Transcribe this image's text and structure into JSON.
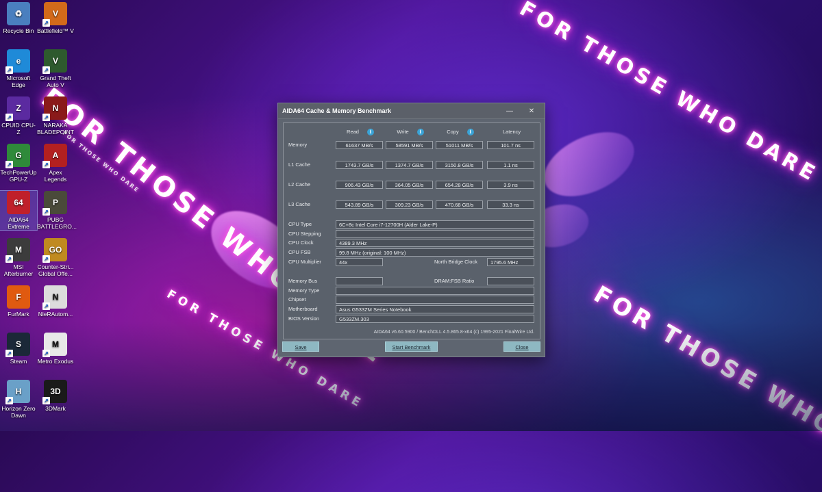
{
  "wallpaper": {
    "slogan": "FOR THOSE WHO DARE"
  },
  "desktop": {
    "icons": [
      {
        "label": "Recycle Bin",
        "icon": "recycle-bin-icon",
        "color": "#4a7fbf",
        "glyph": "♻",
        "shortcut": false
      },
      {
        "label": "Battlefield™ V",
        "icon": "battlefield-icon",
        "color": "#d36a1a",
        "glyph": "V",
        "shortcut": true
      },
      {
        "label": "Microsoft Edge",
        "icon": "edge-icon",
        "color": "#1f8ad8",
        "glyph": "e",
        "shortcut": true
      },
      {
        "label": "Grand Theft Auto V",
        "icon": "gta-icon",
        "color": "#2e5a2e",
        "glyph": "V",
        "shortcut": true
      },
      {
        "label": "CPUID CPU-Z",
        "icon": "cpuz-icon",
        "color": "#5b2aa0",
        "glyph": "Z",
        "shortcut": true
      },
      {
        "label": "NARAKA BLADEPOINT",
        "icon": "naraka-icon",
        "color": "#8a1a1a",
        "glyph": "N",
        "shortcut": true
      },
      {
        "label": "TechPowerUp GPU-Z",
        "icon": "gpuz-icon",
        "color": "#2f8a3a",
        "glyph": "G",
        "shortcut": true
      },
      {
        "label": "Apex Legends",
        "icon": "apex-icon",
        "color": "#b32020",
        "glyph": "A",
        "shortcut": true
      },
      {
        "label": "AIDA64 Extreme",
        "icon": "aida64-icon",
        "color": "#c0202a",
        "glyph": "64",
        "shortcut": false
      },
      {
        "label": "PUBG BATTLEGRO...",
        "icon": "pubg-icon",
        "color": "#4a4a3a",
        "glyph": "P",
        "shortcut": true
      },
      {
        "label": "MSI Afterburner",
        "icon": "afterburner-icon",
        "color": "#3c3c3c",
        "glyph": "M",
        "shortcut": true
      },
      {
        "label": "Counter-Stri... Global Offe...",
        "icon": "csgo-icon",
        "color": "#c08a20",
        "glyph": "GO",
        "shortcut": true
      },
      {
        "label": "FurMark",
        "icon": "furmark-icon",
        "color": "#e05a10",
        "glyph": "F",
        "shortcut": false
      },
      {
        "label": "NieRAutom...",
        "icon": "nier-icon",
        "color": "#dcdcdc",
        "glyph": "N",
        "shortcut": true
      },
      {
        "label": "Steam",
        "icon": "steam-icon",
        "color": "#1b2838",
        "glyph": "S",
        "shortcut": true
      },
      {
        "label": "Metro Exodus",
        "icon": "metro-icon",
        "color": "#e8e8e8",
        "glyph": "M",
        "shortcut": true
      },
      {
        "label": "Horizon Zero Dawn",
        "icon": "horizon-icon",
        "color": "#6aa0c8",
        "glyph": "H",
        "shortcut": true
      },
      {
        "label": "3DMark",
        "icon": "3dmark-icon",
        "color": "#1a1a1a",
        "glyph": "3D",
        "shortcut": true
      }
    ]
  },
  "window": {
    "title": "AIDA64 Cache & Memory Benchmark",
    "minimize": "—",
    "close": "✕",
    "headers": {
      "read": "Read",
      "write": "Write",
      "copy": "Copy",
      "latency": "Latency"
    },
    "info_glyph": "i",
    "rows": [
      {
        "label": "Memory",
        "read": "61637 MB/s",
        "write": "58591 MB/s",
        "copy": "51011 MB/s",
        "latency": "101.7 ns"
      },
      {
        "label": "L1 Cache",
        "read": "1743.7 GB/s",
        "write": "1374.7 GB/s",
        "copy": "3150.8 GB/s",
        "latency": "1.1 ns"
      },
      {
        "label": "L2 Cache",
        "read": "906.43 GB/s",
        "write": "364.05 GB/s",
        "copy": "654.28 GB/s",
        "latency": "3.9 ns"
      },
      {
        "label": "L3 Cache",
        "read": "543.89 GB/s",
        "write": "309.23 GB/s",
        "copy": "470.68 GB/s",
        "latency": "33.3 ns"
      }
    ],
    "cpu": {
      "type_label": "CPU Type",
      "type": "6C+8c Intel Core i7-12700H  (Alder Lake-P)",
      "stepping_label": "CPU Stepping",
      "stepping": "",
      "clock_label": "CPU Clock",
      "clock": "4389.3 MHz",
      "fsb_label": "CPU FSB",
      "fsb": "99.8 MHz  (original: 100 MHz)",
      "multiplier_label": "CPU Multiplier",
      "multiplier": "44x",
      "nb_clock_label": "North Bridge Clock",
      "nb_clock": "1795.6 MHz"
    },
    "mem": {
      "bus_label": "Memory Bus",
      "bus": "",
      "ratio_label": "DRAM:FSB Ratio",
      "ratio": "",
      "type_label": "Memory Type",
      "type": "",
      "chipset_label": "Chipset",
      "chipset": "",
      "motherboard_label": "Motherboard",
      "motherboard": "Asus G533ZM Series Notebook",
      "bios_label": "BIOS Version",
      "bios": "G533ZM.303"
    },
    "footer": "AIDA64 v6.60.5900 / BenchDLL 4.5.865.8-x64  (c) 1995-2021 FinalWire Ltd.",
    "buttons": {
      "save": "Save",
      "start": "Start Benchmark",
      "close": "Close"
    }
  }
}
